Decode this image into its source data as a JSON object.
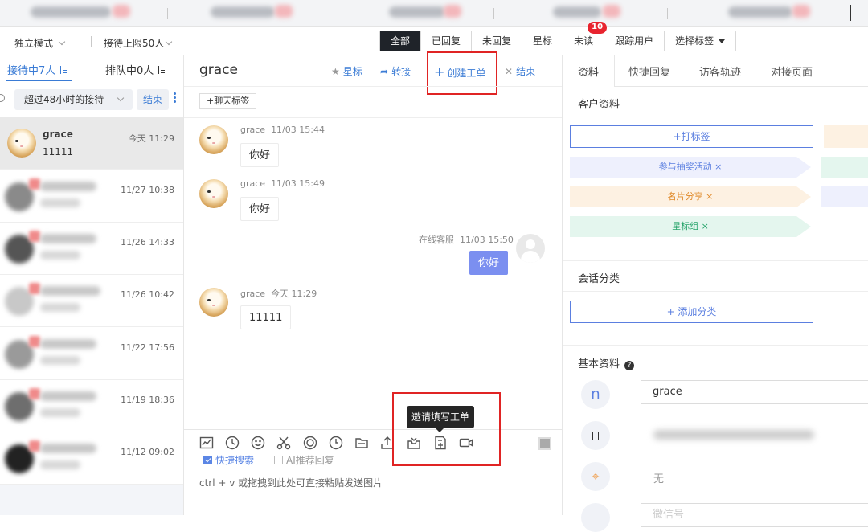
{
  "filter": {
    "mode": "独立模式",
    "limit": "接待上限50人",
    "tabs": [
      "全部",
      "已回复",
      "未回复",
      "星标",
      "未读",
      "跟踪用户",
      "选择标签"
    ],
    "unread_badge": "10"
  },
  "queue": {
    "active_tab": "接待中7人",
    "other_tab": "排队中0人",
    "filter_select": "超过48小时的接待",
    "end_button": "结束"
  },
  "conversations": [
    {
      "name": "grace",
      "preview": "11111",
      "time": "今天 11:29"
    },
    {
      "time": "11/27 10:38"
    },
    {
      "time": "11/26 14:33"
    },
    {
      "time": "11/26 10:42"
    },
    {
      "time": "11/22 17:56"
    },
    {
      "time": "11/19 18:36"
    },
    {
      "time": "11/12 09:02"
    }
  ],
  "chat": {
    "title": "grace",
    "actions": {
      "star": "星标",
      "transfer": "转接",
      "create_ticket": "创建工单",
      "end": "结束"
    },
    "chat_tag_button": "+聊天标签",
    "messages": [
      {
        "sender": "grace",
        "time": "11/03 15:44",
        "text": "你好"
      },
      {
        "sender": "grace",
        "time": "11/03 15:49",
        "text": "你好"
      },
      {
        "sender": "在线客服",
        "time": "11/03 15:50",
        "text": "你好"
      },
      {
        "sender": "grace",
        "time": "今天 11:29",
        "text": "11111"
      }
    ],
    "tooltip": "邀请填写工单",
    "quick_search": "快捷搜索",
    "ai_recommend": "AI推荐回复",
    "input_placeholder": "ctrl + v 或拖拽到此处可直接粘贴发送图片"
  },
  "right": {
    "tabs": [
      "资料",
      "快捷回复",
      "访客轨迹",
      "对接页面"
    ],
    "customer_profile": "客户资料",
    "tag_button": "+打标签",
    "tags": [
      "参与抽奖活动 ×",
      "名片分享 ×",
      "星标组 ×"
    ],
    "session_category": "会话分类",
    "add_category": "+ 添加分类",
    "basic_info": "基本资料",
    "avatar_letter": "n",
    "name_value": "grace",
    "location_value": "无",
    "next_placeholder": "微信号"
  },
  "colors": {
    "accent": "#5b7fe0",
    "link": "#3a7bd5",
    "red": "#e02424",
    "dark_tab": "#1f2329",
    "customer_bubble": "#7b8ff0"
  }
}
